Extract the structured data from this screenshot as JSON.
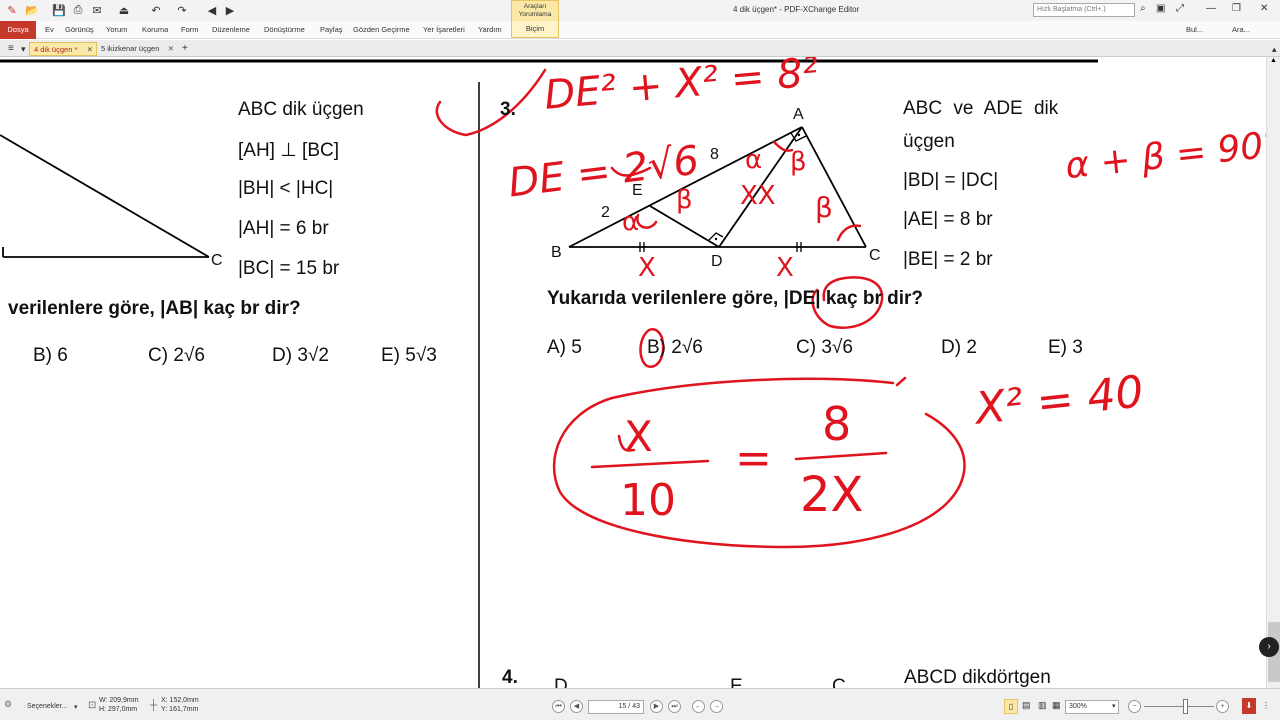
{
  "window": {
    "title": "4 dik üçgen* - PDF-XChange Editor",
    "context_tab_line1": "Araçları",
    "context_tab_line2": "Yorumlama",
    "search_placeholder": "Hızlı Başlatma (Ctrl+.)",
    "right_tools": [
      "Bul...",
      "Ara..."
    ]
  },
  "menu": {
    "file": "Dosya",
    "items": [
      "Ev",
      "Görünüş",
      "Yorum",
      "Koruma",
      "Form",
      "Düzenleme",
      "Dönüştürme",
      "Paylaş",
      "Gözden Geçirme",
      "Yer İşaretleri",
      "Yardım"
    ],
    "active": "Biçim"
  },
  "tabs": [
    {
      "label": "4 dik üçgen *",
      "active": true
    },
    {
      "label": "5 ikizkenar üçgen",
      "active": false
    }
  ],
  "page": {
    "left_problem": {
      "given_lines": [
        "ABC dik üçgen",
        "[AH] ⊥ [BC]",
        "|BH| < |HC|",
        "|AH| = 6 br",
        "|BC| = 15 br"
      ],
      "vertex_c": "C",
      "question": "verilenlere göre, |AB| kaç br dir?",
      "options": [
        "B) 6",
        "C) 2√6",
        "D) 3√2",
        "E) 5√3"
      ]
    },
    "problem3": {
      "number": "3.",
      "vertices": {
        "A": "A",
        "B": "B",
        "C": "C",
        "D": "D",
        "E": "E"
      },
      "label_8": "8",
      "label_2": "2",
      "given_lines": [
        "ABC ve ADE dik",
        "üçgen",
        "|BD| = |DC|",
        "|AE| = 8 br",
        "|BE| = 2 br"
      ],
      "question": "Yukarıda verilenlere göre, |DE| kaç br dir?",
      "options": [
        "A) 5",
        "B) 2√6",
        "C) 3√6",
        "D) 2",
        "E) 3"
      ]
    },
    "problem4": {
      "number": "4.",
      "partial_labels": [
        "D",
        "E",
        "C"
      ],
      "given": "ABCD dikdörtgen"
    },
    "handwriting": {
      "eq_top": "DE² + X² = 8²",
      "de_result": "DE = 2√6",
      "angle_sum": "α + β = 90°",
      "x_squared": "X² = 40",
      "fraction_left_num": "X",
      "fraction_left_den": "10",
      "equals": "=",
      "fraction_right_num": "8",
      "fraction_right_den": "2X",
      "alpha": "α",
      "beta": "β",
      "x_mark": "X",
      "xx_mark": "XX",
      "ink_color": "#e0141e"
    }
  },
  "status": {
    "options_label": "Seçenekler...",
    "width": "W: 209,9mm",
    "height": "H: 297,0mm",
    "x": "X: 152,0mm",
    "y": "Y: 161,7mm",
    "page_field": "15 / 43",
    "zoom": "300%"
  }
}
